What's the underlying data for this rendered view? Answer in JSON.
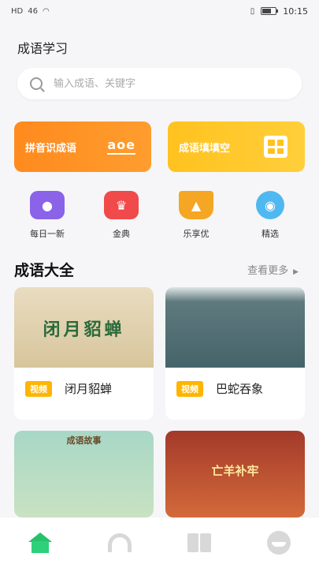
{
  "status_bar": {
    "left": "HD",
    "signal": "46",
    "time": "10:15"
  },
  "header": {
    "title": "成语学习"
  },
  "search": {
    "placeholder": "输入成语、关键字"
  },
  "feature_cards": [
    {
      "label": "拼音识成语",
      "badge": "aoe"
    },
    {
      "label": "成语填填空"
    }
  ],
  "categories": [
    {
      "label": "每日一新",
      "icon": "daily-icon"
    },
    {
      "label": "金典",
      "icon": "crown-icon"
    },
    {
      "label": "乐享优",
      "icon": "graduation-cap-icon"
    },
    {
      "label": "精选",
      "icon": "star-badge-icon"
    }
  ],
  "section": {
    "title": "成语大全",
    "more": "查看更多"
  },
  "videos": [
    {
      "badge": "视频",
      "title": "闭月貂蝉",
      "thumb_text": "闭月貂蝉"
    },
    {
      "badge": "视频",
      "title": "巴蛇吞象",
      "thumb_text": ""
    },
    {
      "badge": "",
      "title": "",
      "thumb_text": "成语故事"
    },
    {
      "badge": "",
      "title": "",
      "thumb_text": "亡羊补牢"
    }
  ],
  "tabbar": [
    {
      "icon": "home-icon",
      "active": true
    },
    {
      "icon": "headphone-icon",
      "active": false
    },
    {
      "icon": "book-icon",
      "active": false
    },
    {
      "icon": "face-icon",
      "active": false
    }
  ],
  "colors": {
    "accent_orange": "#ff8a1e",
    "accent_yellow": "#ffc21f",
    "badge": "#ffb400",
    "tab_active": "#25c26b"
  }
}
